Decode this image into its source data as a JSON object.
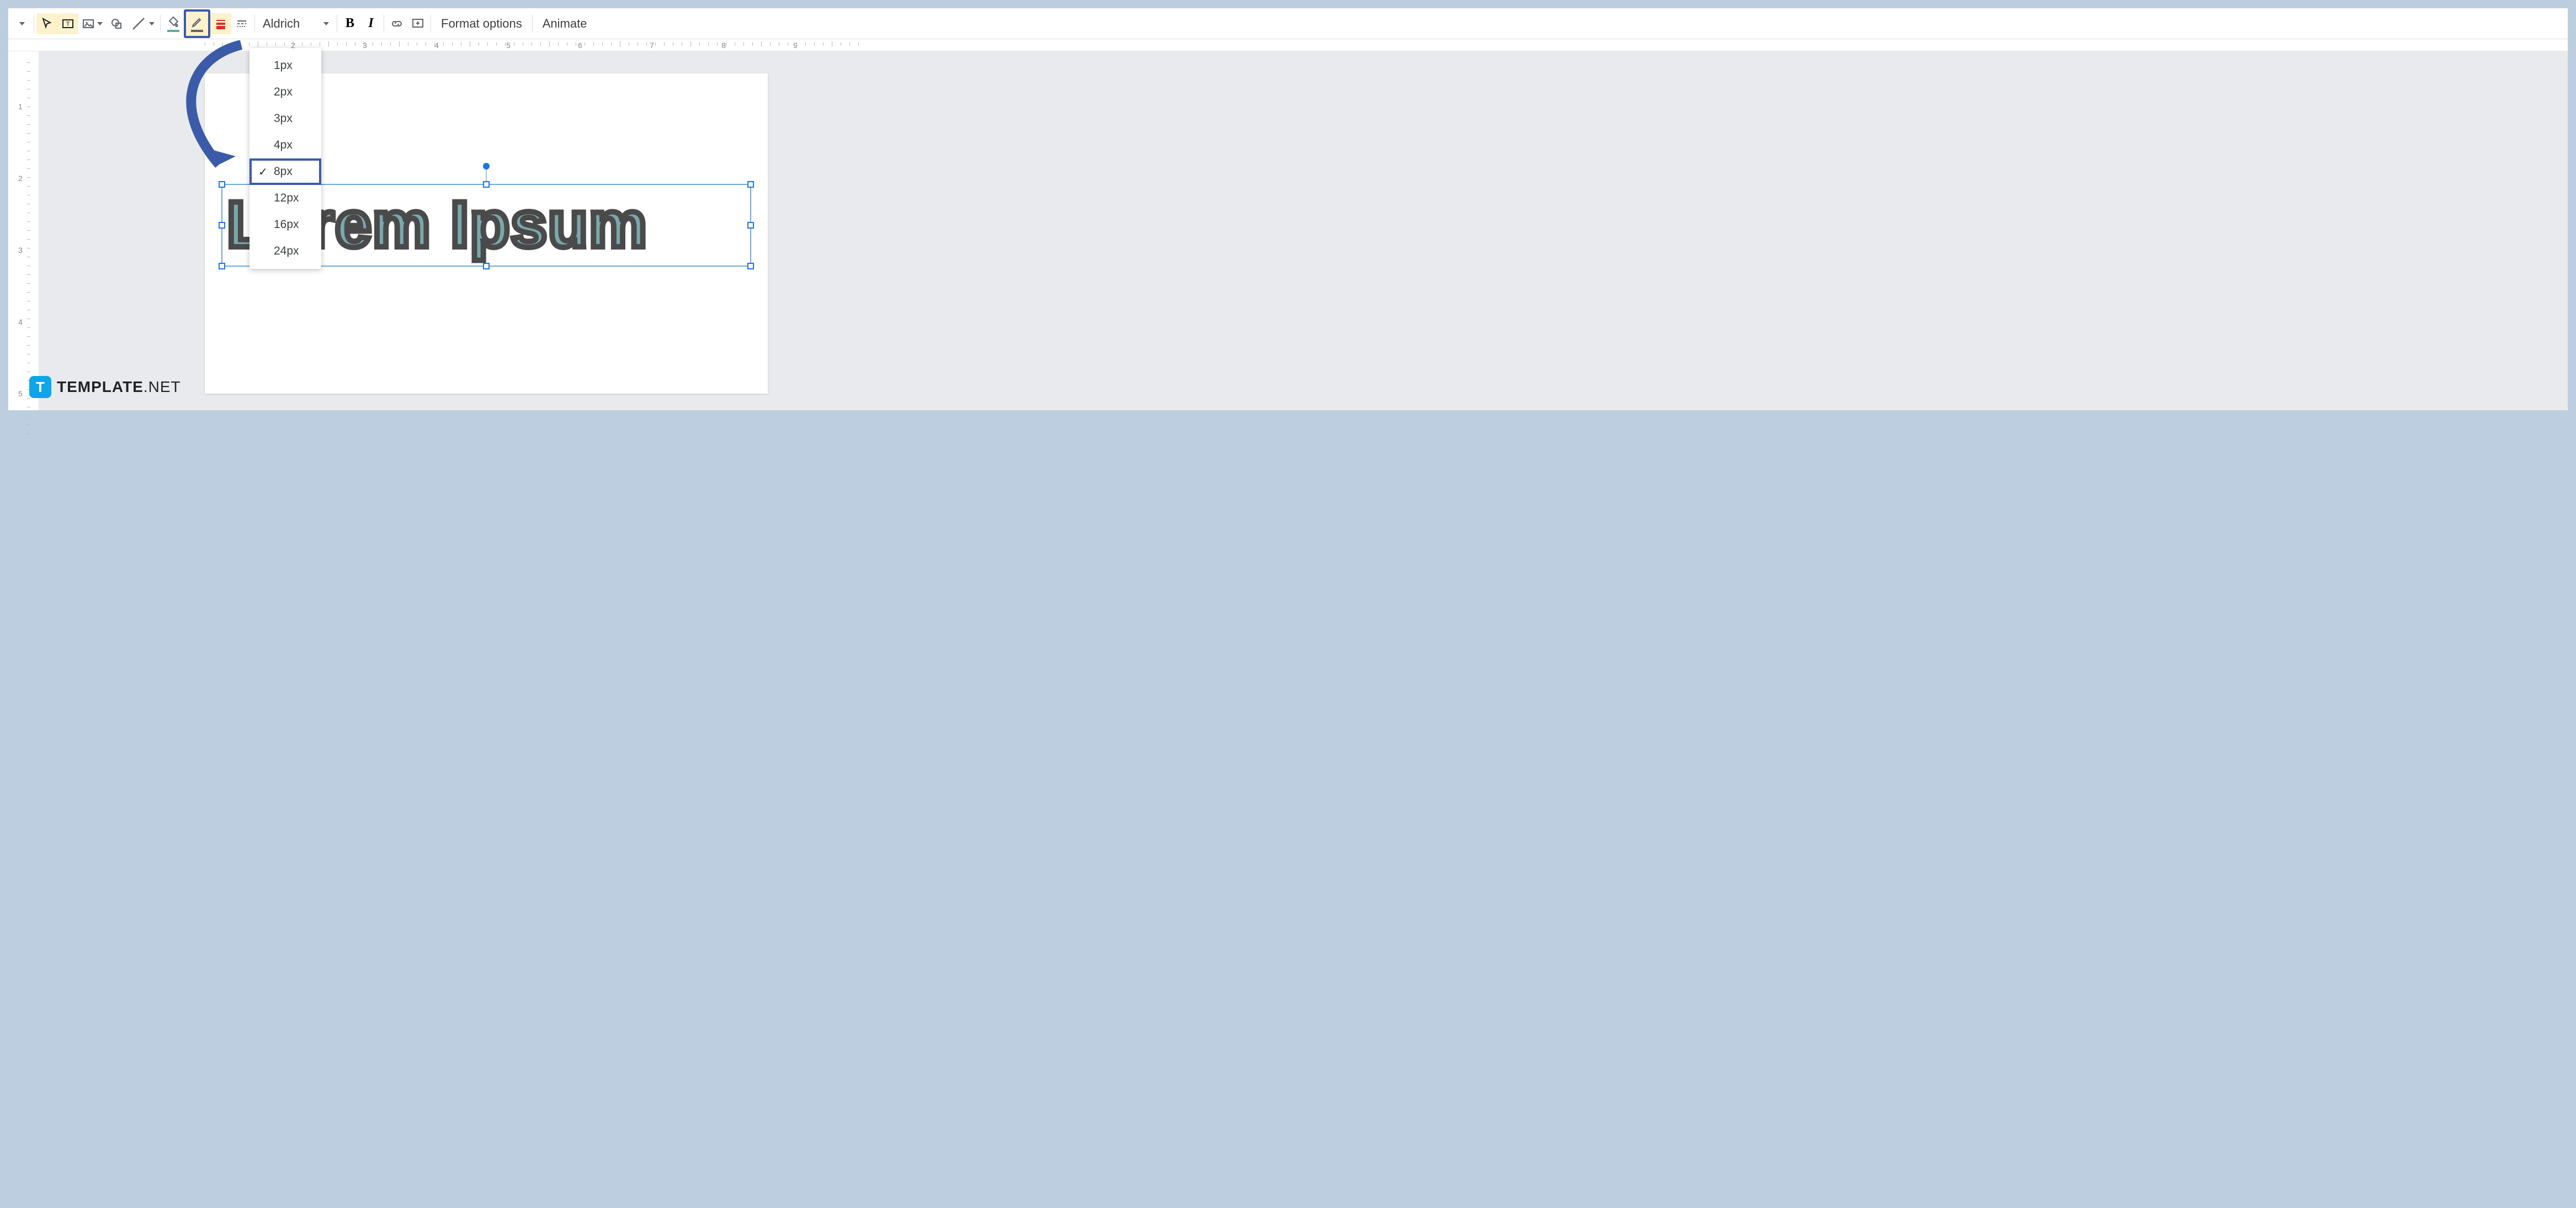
{
  "toolbar": {
    "font": "Aldrich",
    "format_options": "Format options",
    "animate": "Animate"
  },
  "dropdown": {
    "items": [
      {
        "label": "1px",
        "selected": false
      },
      {
        "label": "2px",
        "selected": false
      },
      {
        "label": "3px",
        "selected": false
      },
      {
        "label": "4px",
        "selected": false
      },
      {
        "label": "8px",
        "selected": true
      },
      {
        "label": "12px",
        "selected": false
      },
      {
        "label": "16px",
        "selected": false
      },
      {
        "label": "24px",
        "selected": false
      }
    ]
  },
  "ruler": {
    "horizontal": [
      "2",
      "3",
      "4",
      "5",
      "6",
      "7",
      "8",
      "9"
    ],
    "vertical": [
      "1",
      "2",
      "3",
      "4",
      "5"
    ]
  },
  "canvas": {
    "wordart_text": "Lorem Ipsum"
  },
  "watermark": {
    "icon_letter": "T",
    "bold": "TEMPLATE",
    "light": ".NET"
  },
  "colors": {
    "highlight_border": "#3b5ba9",
    "fill_color": "#5fa8a0",
    "border_color": "#5f6368",
    "border_weight_color": "#d93025"
  }
}
